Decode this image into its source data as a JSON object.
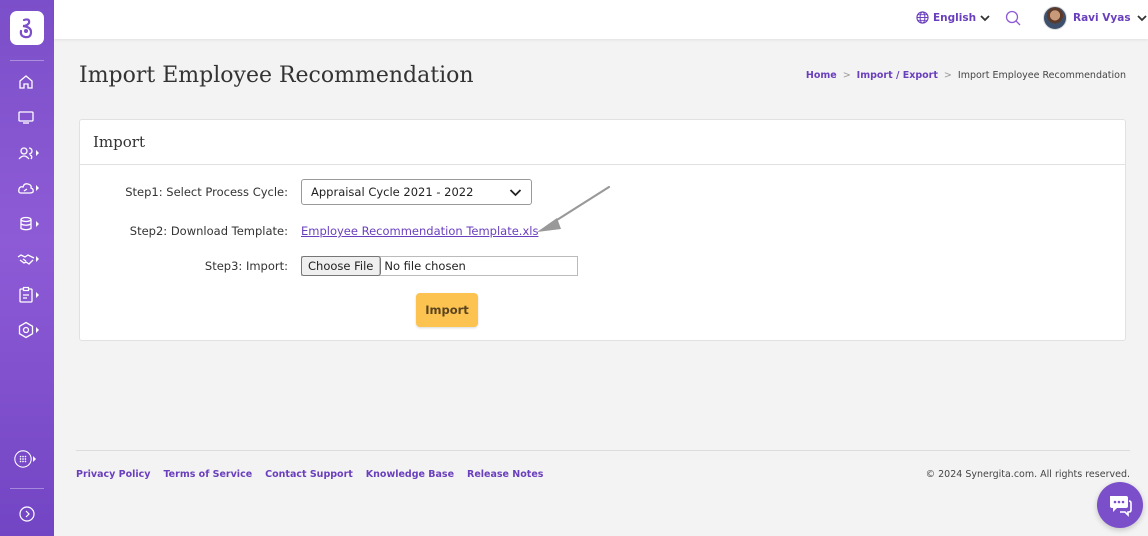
{
  "topbar": {
    "language": "English",
    "user_name": "Ravi Vyas"
  },
  "page": {
    "title": "Import Employee Recommendation"
  },
  "breadcrumb": {
    "home": "Home",
    "section": "Import / Export",
    "current": "Import Employee Recommendation"
  },
  "card": {
    "title": "Import",
    "step1_label": "Step1: Select Process Cycle:",
    "step1_value": "Appraisal Cycle 2021 - 2022",
    "step2_label": "Step2: Download Template:",
    "step2_link": "Employee Recommendation Template.xls",
    "step3_label": "Step3: Import:",
    "choose_file": "Choose File",
    "no_file": "No file chosen",
    "import_button": "Import"
  },
  "footer": {
    "links": [
      "Privacy Policy",
      "Terms of Service",
      "Contact Support",
      "Knowledge Base",
      "Release Notes"
    ],
    "copyright": "© 2024 Synergita.com. All rights reserved."
  },
  "colors": {
    "brand": "#7b4fc9",
    "link": "#6a3fbd",
    "import_button": "#fdc350"
  },
  "sidebar_icons": [
    "home-icon",
    "monitor-icon",
    "users-icon",
    "cloud-icon",
    "database-icon",
    "handshake-icon",
    "clipboard-icon",
    "settings-icon",
    "apps-icon",
    "expand-icon"
  ]
}
